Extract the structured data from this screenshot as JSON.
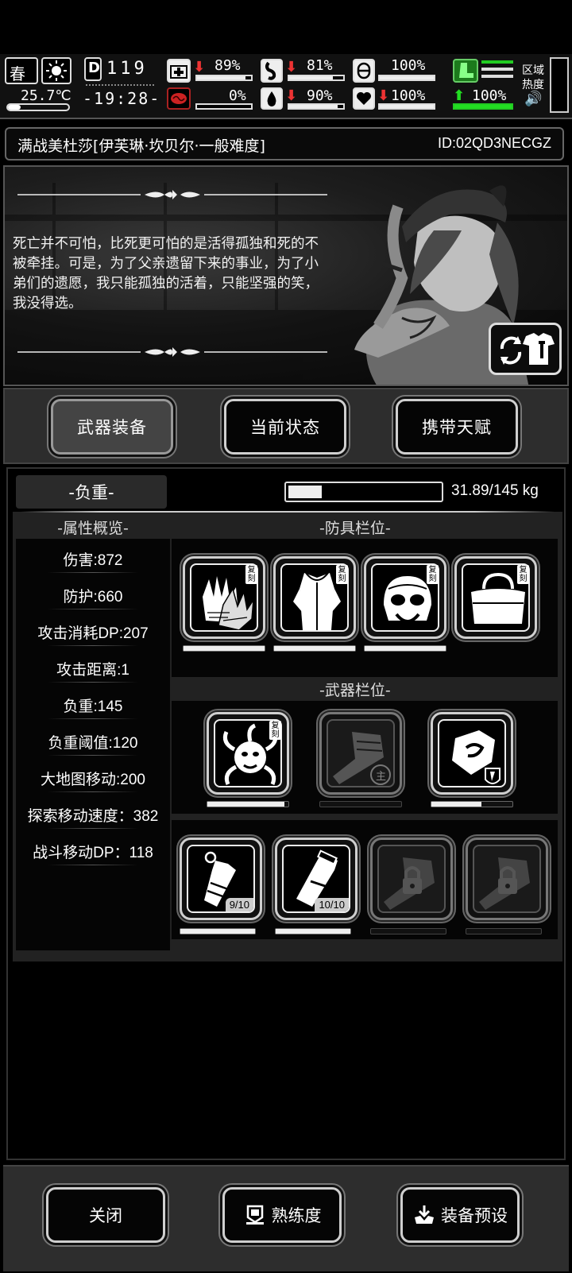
{
  "status": {
    "season": "春",
    "temperature": "25.7℃",
    "day": "119",
    "time": "-19:28-",
    "health_pct": "89%",
    "infection_pct": "0%",
    "hunger_pct": "81%",
    "thirst_pct": "90%",
    "energy_pct": "100%",
    "mood_pct": "100%",
    "stamina_pct": "100%",
    "zone_label_1": "区域",
    "zone_label_2": "热度",
    "bars": {
      "health": 0.89,
      "infection": 0.0,
      "hunger": 0.81,
      "thirst": 0.9,
      "energy": 1.0,
      "mood": 1.0,
      "stamina": 1.0
    }
  },
  "title": {
    "left": "满战美杜莎[伊芙琳·坎贝尔·一般难度]",
    "right": "ID:02QD3NECGZ"
  },
  "portrait": {
    "quote": "死亡并不可怕，比死更可怕的是活得孤独和死的不被牵挂。可是，为了父亲遗留下来的事业，为了小弟们的遗愿，我只能孤独的活着，只能坚强的笑，我没得选。"
  },
  "tabs": {
    "weapons": "武器装备",
    "status": "当前状态",
    "talents": "携带天赋"
  },
  "weight": {
    "label": "-负重-",
    "value_text": "31.89/145 kg",
    "fraction": 0.22
  },
  "attributes": {
    "heading": "-属性概览-",
    "items": [
      "伤害:872",
      "防护:660",
      "攻击消耗DP:207",
      "攻击距离:1",
      "负重:145",
      "负重阈值:120",
      "大地图移动:200",
      "探索移动速度：382",
      "战斗移动DP：118"
    ]
  },
  "armor": {
    "heading": "-防具栏位-",
    "tag": "复刻",
    "slots": [
      {
        "icon": "gloves-icon",
        "durability": 1.0
      },
      {
        "icon": "coat-icon",
        "durability": 1.0
      },
      {
        "icon": "helmet-icon",
        "durability": 1.0
      },
      {
        "icon": "bag-icon",
        "durability": 0.0
      }
    ]
  },
  "weapons": {
    "heading": "-武器栏位-",
    "main_label": "主",
    "slots": [
      {
        "icon": "medusa-weapon-icon",
        "durability": 0.95,
        "tagged": true
      },
      {
        "icon": "fist-icon",
        "durability": 0.0,
        "tagged": false
      },
      {
        "icon": "gauntlet-shield-icon",
        "durability": 0.62,
        "tagged": false
      }
    ]
  },
  "consumables": {
    "slots": [
      {
        "icon": "grenade-icon",
        "count": "9/10",
        "durability": 1.0
      },
      {
        "icon": "flashlight-icon",
        "count": "10/10",
        "durability": 1.0
      },
      {
        "icon": "locked-fist-icon",
        "count": "",
        "durability": 0.0
      },
      {
        "icon": "locked-fist-icon",
        "count": "",
        "durability": 0.0
      }
    ]
  },
  "buttons": {
    "close": "关闭",
    "proficiency": "熟练度",
    "preset": "装备预设"
  }
}
